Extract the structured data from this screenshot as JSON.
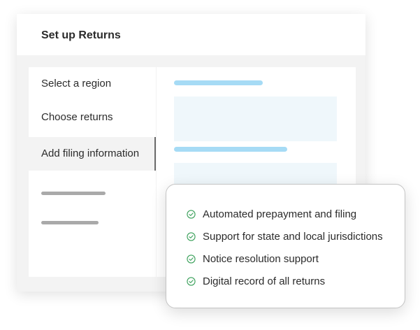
{
  "card": {
    "title": "Set up Returns"
  },
  "sidebar": {
    "items": [
      {
        "label": "Select a region"
      },
      {
        "label": "Choose returns"
      },
      {
        "label": "Add filing information",
        "active": true
      }
    ]
  },
  "features": [
    {
      "label": "Automated prepayment and filing",
      "icon": "check-circle-icon"
    },
    {
      "label": "Support for state and local jurisdictions",
      "icon": "check-circle-icon"
    },
    {
      "label": "Notice resolution support",
      "icon": "check-circle-icon"
    },
    {
      "label": "Digital record of all returns",
      "icon": "check-circle-icon"
    }
  ],
  "colors": {
    "check_green": "#3aa05a",
    "placeholder_blue": "#a6dbf5",
    "placeholder_light": "#eff7fb",
    "placeholder_gray": "#a9a9a9"
  }
}
